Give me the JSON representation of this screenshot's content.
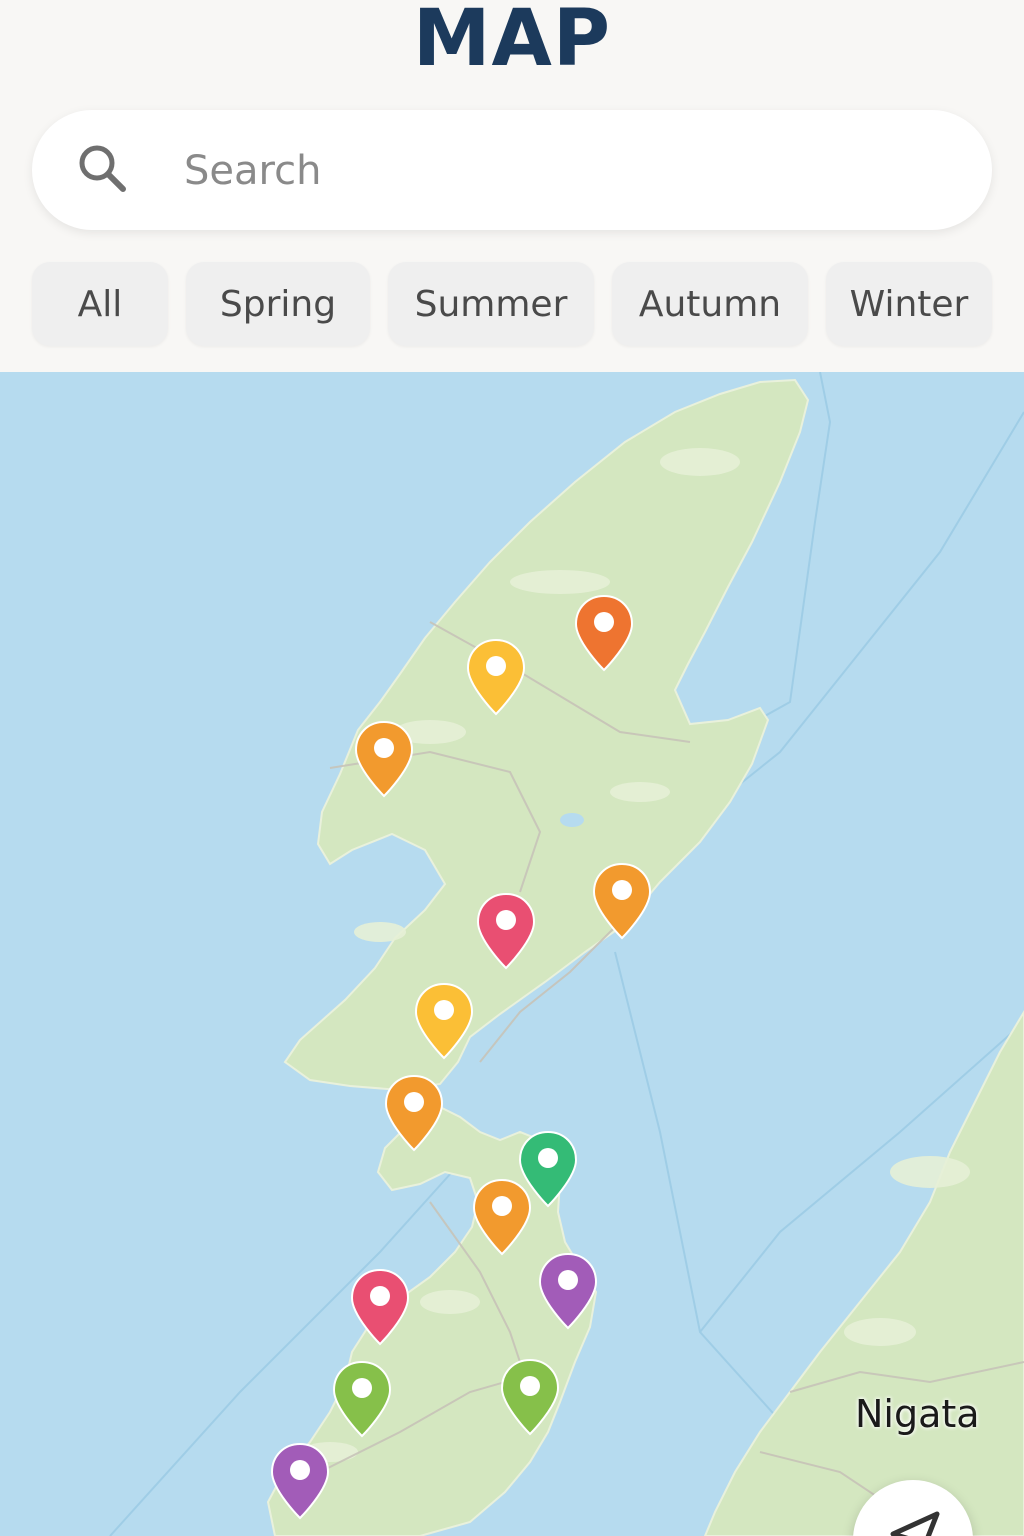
{
  "header": {
    "title": "MAP"
  },
  "search": {
    "placeholder": "Search",
    "icon": "search-icon"
  },
  "filters": [
    {
      "label": "All"
    },
    {
      "label": "Spring"
    },
    {
      "label": "Summer"
    },
    {
      "label": "Autumn"
    },
    {
      "label": "Winter"
    }
  ],
  "map": {
    "place_label": "Nigata",
    "colors": {
      "water": "#b6dbef",
      "land": "#d4e7c0",
      "pin_orange": "#f29a2e",
      "pin_dark_orange": "#ee7430",
      "pin_yellow": "#fbbf36",
      "pin_pink": "#e94f72",
      "pin_green": "#34bb76",
      "pin_lime": "#86c04a",
      "pin_purple": "#a25cb8"
    },
    "pins": [
      {
        "color": "pin_dark_orange"
      },
      {
        "color": "pin_yellow"
      },
      {
        "color": "pin_orange"
      },
      {
        "color": "pin_orange"
      },
      {
        "color": "pin_pink"
      },
      {
        "color": "pin_yellow"
      },
      {
        "color": "pin_orange"
      },
      {
        "color": "pin_green"
      },
      {
        "color": "pin_orange"
      },
      {
        "color": "pin_purple"
      },
      {
        "color": "pin_pink"
      },
      {
        "color": "pin_lime"
      },
      {
        "color": "pin_lime"
      },
      {
        "color": "pin_purple"
      }
    ],
    "locate_icon": "navigation-arrow-icon"
  }
}
